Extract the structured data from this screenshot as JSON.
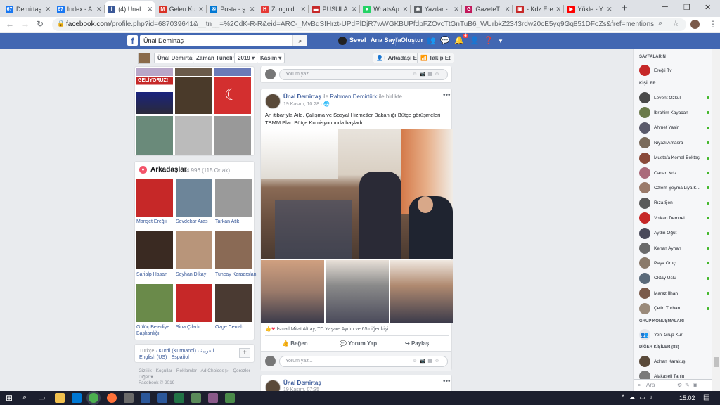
{
  "tabs": [
    {
      "label": "Demirtaş",
      "fav": "67",
      "color": "#1877f2"
    },
    {
      "label": "Index - A",
      "fav": "67",
      "color": "#1877f2"
    },
    {
      "label": "(4) Ünal",
      "fav": "f",
      "color": "#3b5998"
    },
    {
      "label": "Gelen Ku",
      "fav": "M",
      "color": "#d93025"
    },
    {
      "label": "Posta - ş",
      "fav": "✉",
      "color": "#0078d4"
    },
    {
      "label": "Zonguldi",
      "fav": "H",
      "color": "#e53935"
    },
    {
      "label": "PUSULA",
      "fav": "▬",
      "color": "#c62828"
    },
    {
      "label": "WhatsAp",
      "fav": "●",
      "color": "#25d366"
    },
    {
      "label": "Yazılar -",
      "fav": "◉",
      "color": "#5f6368"
    },
    {
      "label": "GazeteT",
      "fav": "G",
      "color": "#c2185b"
    },
    {
      "label": "- Kdz.Ere",
      "fav": "▣",
      "color": "#c62828"
    },
    {
      "label": "Yükle - Y",
      "fav": "▶",
      "color": "#ff0000"
    }
  ],
  "url": {
    "host": "facebook.com",
    "path": "/profile.php?id=687039641&__tn__=%2CdK-R-R&eid=ARC-_MvBqS!Hrzt-UPdPlDjR7wWGKBUPfdpFZOvcTtGnTuB6_WUrbkZ2343rdw20cE5yq9Gq851DFoZs&fref=mentions"
  },
  "fb": {
    "search_value": "Ünal Demirtaş",
    "user_name": "Seval",
    "home": "Ana Sayfa",
    "create": "Oluştur",
    "notif_count": "4"
  },
  "timeline": {
    "name": "Ünal Demirtaş",
    "tab": "Zaman Tüneli",
    "year": "2019",
    "month": "Kasım",
    "add_friend": "Arkadaşı Ekle",
    "follow": "Takip Et"
  },
  "friends": {
    "title": "Arkadaşlar",
    "count": "· 4.996 (115 Ortak)",
    "items": [
      {
        "name": "Manşet Ereğli",
        "color": "#c62828"
      },
      {
        "name": "Sevdekar Aras",
        "color": "#6d8599"
      },
      {
        "name": "Tarkan Atik",
        "color": "#9a9a9a"
      },
      {
        "name": "Sarialp Hasan",
        "color": "#3a2a22"
      },
      {
        "name": "Seyhan Dikay",
        "color": "#b8957a"
      },
      {
        "name": "Tuncay Karaarslan",
        "color": "#8a6a55"
      },
      {
        "name": "Gülüç Belediye Başkanlığı",
        "color": "#6a8a4a"
      },
      {
        "name": "Sina Çiladır",
        "color": "#c62828"
      },
      {
        "name": "Ozge Cerrah",
        "color": "#4a3a32"
      }
    ]
  },
  "languages": {
    "line1": [
      "Türkçe",
      "Kurdî (Kurmancî)",
      "العربية"
    ],
    "line2": [
      "English (US)",
      "Español"
    ]
  },
  "footer": {
    "links": [
      "Gizlilik",
      "Koşullar",
      "Reklamlar",
      "Ad Choices ▷",
      "Çerezler",
      "Diğer ▾"
    ],
    "copyright": "Facebook © 2019"
  },
  "comment_placeholder": "Yorum yaz...",
  "post": {
    "author": "Ünal Demirtaş",
    "with_text": "Rahman Demirtürk ile birlikte.",
    "with_name": "Rahman Demirtürk",
    "with_suffix": " ile birlikte.",
    "time": "19 Kasım, 10:28 · ",
    "text": "An itibarıyla Aile, Çalışma ve Sosyal Hizmetler Bakanlığı Bütçe görüşmeleri TBMM Plan Bütçe Komisyonunda başladı.",
    "reactions": "İsmail Mitat Altıay, TC Yaşare Aydın ve 65 diğer kişi",
    "like": "Beğen",
    "comment": "Yorum Yap",
    "share": "Paylaş"
  },
  "post2": {
    "author": "Ünal Demirtaş",
    "time": "19 Kasım, 07:35"
  },
  "sidebar": {
    "pages_head": "SAYFALARIN",
    "pages": [
      {
        "name": "Ereğli Tv",
        "color": "#c62828"
      }
    ],
    "contacts_head": "KİŞİLER",
    "contacts": [
      {
        "name": "Levent Özkul",
        "color": "#4a4a4a"
      },
      {
        "name": "İbrahim Kayacan",
        "color": "#6a7a4a"
      },
      {
        "name": "Ahmet Yasin",
        "color": "#5a5a6a"
      },
      {
        "name": "Niyazi Amasra",
        "color": "#7a6a5a"
      },
      {
        "name": "Mustafa Kemal Bektaş",
        "color": "#8a4a3a"
      },
      {
        "name": "Canan Kdz",
        "color": "#aa6a7a"
      },
      {
        "name": "Özlem Şeyma Liya K...",
        "color": "#9a7a6a"
      },
      {
        "name": "Rıza Şen",
        "color": "#5a5a5a"
      },
      {
        "name": "Volkan Demirel",
        "color": "#c62828"
      },
      {
        "name": "Aydın Öğüt",
        "color": "#4a4a5a"
      },
      {
        "name": "Kenan Ayhan",
        "color": "#6a6a6a"
      },
      {
        "name": "Paşa Oruç",
        "color": "#8a7a6a"
      },
      {
        "name": "Oktay Uslu",
        "color": "#5a6a7a"
      },
      {
        "name": "Maraz İlhan",
        "color": "#7a5a4a"
      },
      {
        "name": "Çetin Turhan",
        "color": "#9a8a7a"
      }
    ],
    "groups_head": "GRUP KONUŞMALARI",
    "new_group": "Yeni Grup Kur",
    "others_head": "DİĞER KİŞİLER (88)",
    "others": [
      {
        "name": "Adnan Karakuş",
        "color": "#5a4a3a"
      },
      {
        "name": "Alakaseli Tanju",
        "color": "#7a7a7a"
      }
    ],
    "search_placeholder": "Ara"
  },
  "taskbar": {
    "time": "15:02"
  },
  "colors": {
    "fb_blue": "#4267b2",
    "link": "#385898"
  }
}
